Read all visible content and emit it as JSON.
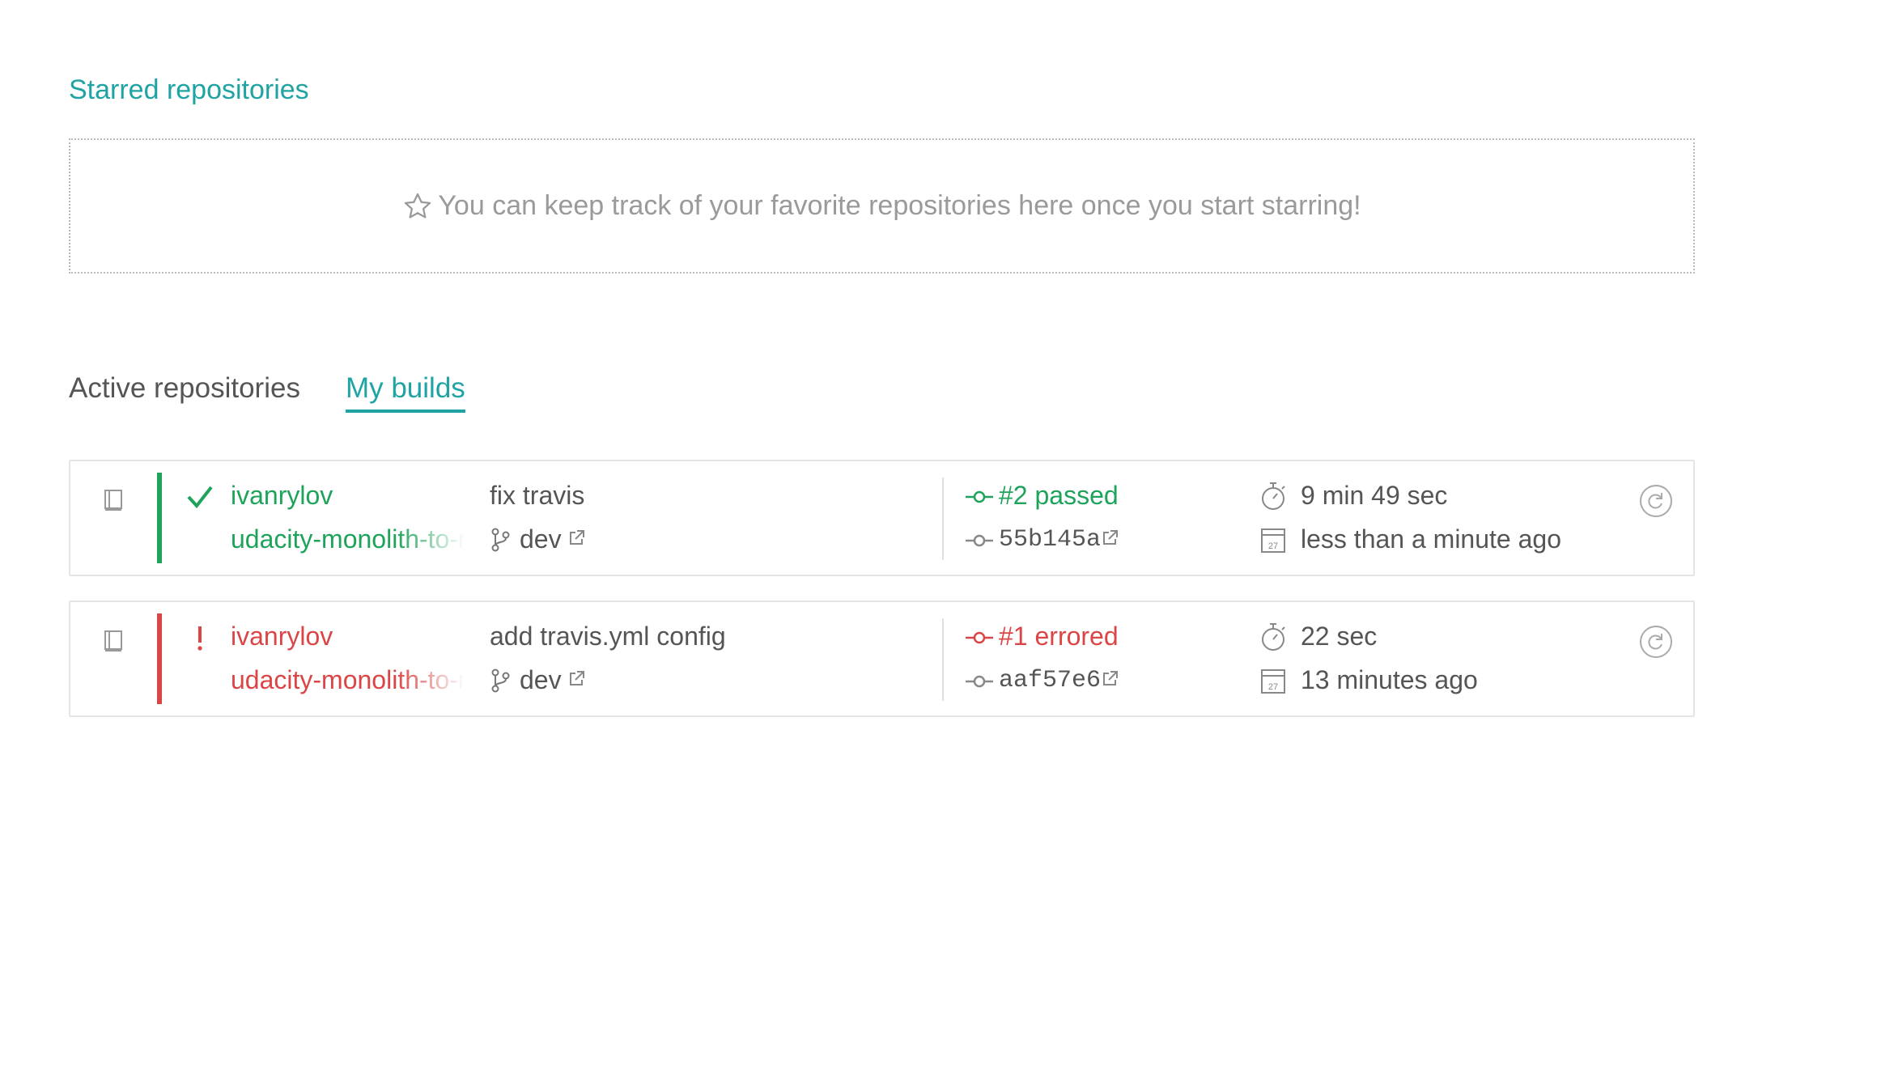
{
  "starred": {
    "title": "Starred repositories",
    "empty_message": "You can keep track of your favorite repositories here once you start starring!"
  },
  "tabs": [
    {
      "label": "Active repositories",
      "active": false
    },
    {
      "label": "My builds",
      "active": true
    }
  ],
  "builds": [
    {
      "state": "passed",
      "owner": "ivanrylov",
      "repo": "udacity-monolith-to-microservices",
      "commit_message": "fix travis",
      "branch": "dev",
      "build_label": "#2 passed",
      "sha": "55b145a",
      "duration": "9 min 49 sec",
      "finished": "less than a minute ago"
    },
    {
      "state": "errored",
      "owner": "ivanrylov",
      "repo": "udacity-monolith-to-microservices",
      "commit_message": "add travis.yml config",
      "branch": "dev",
      "build_label": "#1 errored",
      "sha": "aaf57e6",
      "duration": "22 sec",
      "finished": "13 minutes ago"
    }
  ],
  "colors": {
    "accent": "#1fa3a3",
    "passed": "#1ea35a",
    "errored": "#db4545"
  }
}
